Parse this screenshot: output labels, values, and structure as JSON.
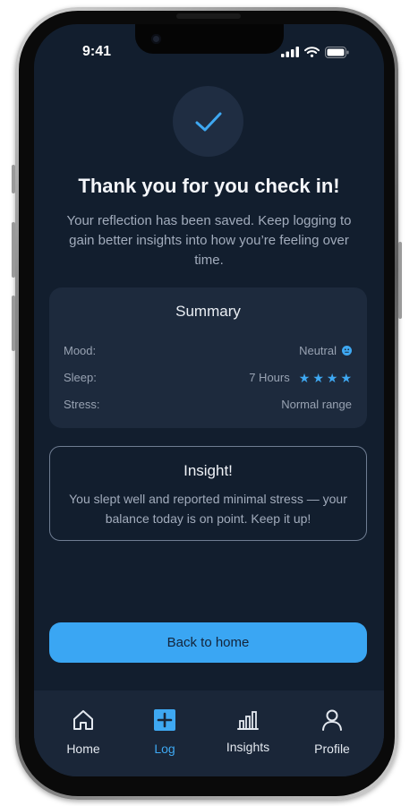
{
  "status_bar": {
    "time": "9:41"
  },
  "confirmation": {
    "title": "Thank you for you check in!",
    "message": "Your reflection has been saved. Keep logging to gain better insights into how you’re feeling over time."
  },
  "summary": {
    "title": "Summary",
    "rows": [
      {
        "label": "Mood:",
        "value": "Neutral"
      },
      {
        "label": "Sleep:",
        "value": "7 Hours",
        "rating": 4
      },
      {
        "label": "Stress:",
        "value": "Normal range"
      }
    ]
  },
  "insight": {
    "title": "Insight!",
    "body": "You slept well and reported minimal stress — your balance today is on point. Keep it up!"
  },
  "primary_action": {
    "label": "Back to home"
  },
  "tabs": [
    {
      "label": "Home",
      "icon": "home-icon"
    },
    {
      "label": "Log",
      "icon": "plus-icon",
      "active": true
    },
    {
      "label": "Insights",
      "icon": "bar-chart-icon"
    },
    {
      "label": "Profile",
      "icon": "user-icon"
    }
  ],
  "colors": {
    "background": "#121e2e",
    "card": "#1d2a3d",
    "accent": "#3aa6f3",
    "tabbar": "#1a2638"
  }
}
